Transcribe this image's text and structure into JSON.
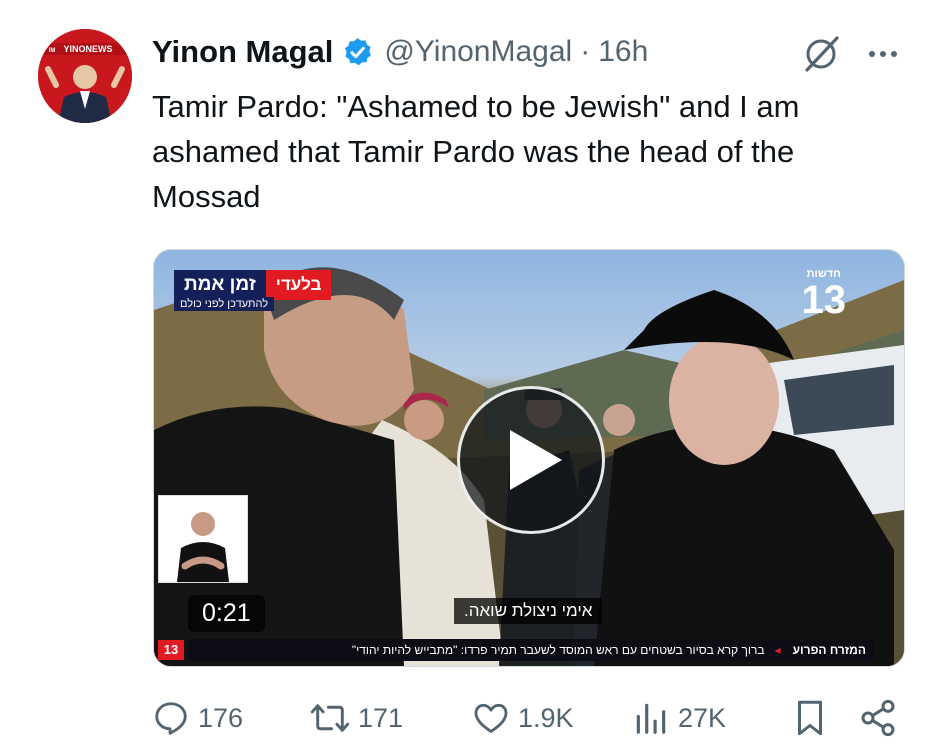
{
  "author": {
    "name": "Yinon Magal",
    "handle": "@YinonMagal",
    "separator": "·",
    "time": "16h",
    "avatar_badge": "YINONEWS",
    "avatar_badge_prefix": "IM",
    "verified_color": "#1d9bf0"
  },
  "tweet": {
    "text": "Tamir Pardo: \"Ashamed to be Jewish\" and I am\nashamed that Tamir Pardo was the head of the\nMossad"
  },
  "video": {
    "duration": "0:21",
    "live_red": "בלעדי",
    "live_title": "זמן אמת",
    "live_sub": "להתעדכן לפני כולם",
    "channel_small": "חדשות",
    "channel_number": "13",
    "subtitle": "אימי ניצולת שואה.",
    "ticker_tag": "המזרח הפרוע",
    "ticker_text": "ברוך קרא בסיור בשטחים עם ראש המוסד לשעבר תמיר פרדו: \"מתבייש להיות יהודי\"",
    "ticker_logo": "13"
  },
  "actions": {
    "replies": "176",
    "reposts": "171",
    "likes": "1.9K",
    "views": "27K"
  },
  "icons": {
    "verified": "verified-badge-icon",
    "grok": "grok-icon",
    "more": "more-icon",
    "reply": "reply-icon",
    "repost": "repost-icon",
    "like": "like-icon",
    "views": "views-icon",
    "bookmark": "bookmark-icon",
    "share": "share-icon",
    "play": "play-icon"
  }
}
